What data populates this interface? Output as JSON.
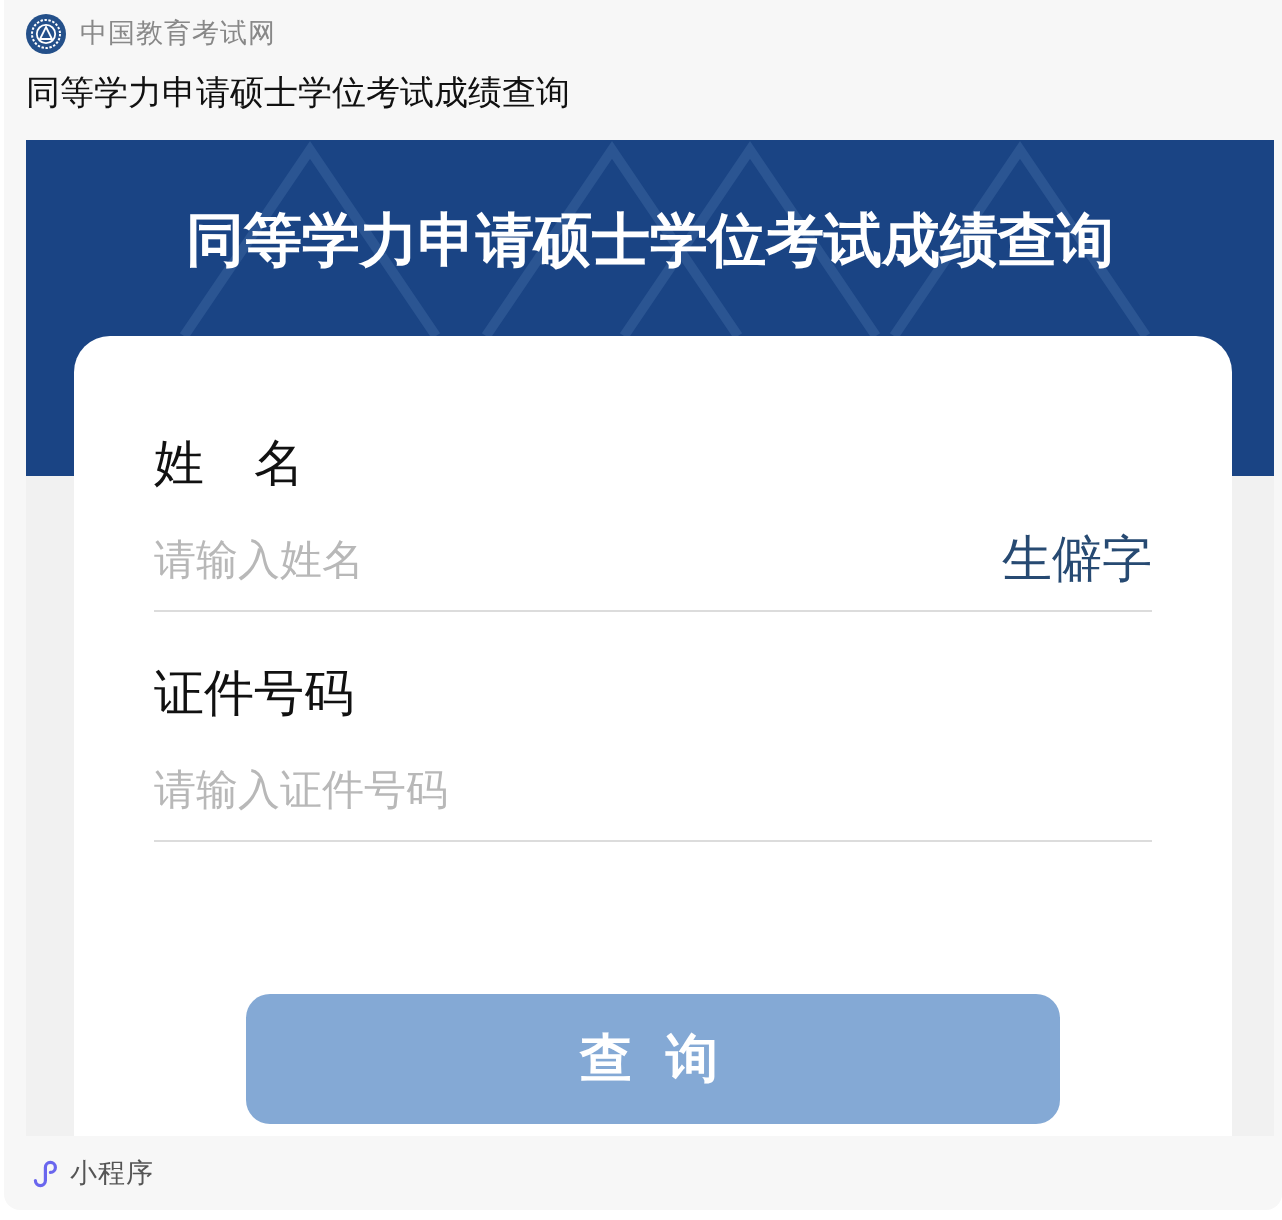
{
  "source": {
    "name": "中国教育考试网"
  },
  "title": "同等学力申请硕士学位考试成绩查询",
  "preview": {
    "banner_title": "同等学力申请硕士学位考试成绩查询",
    "fields": [
      {
        "label": "姓　名",
        "placeholder": "请输入姓名",
        "action": "生僻字"
      },
      {
        "label": "证件号码",
        "placeholder": "请输入证件号码"
      }
    ],
    "submit_button": "查 询"
  },
  "footer": {
    "label": "小程序"
  }
}
